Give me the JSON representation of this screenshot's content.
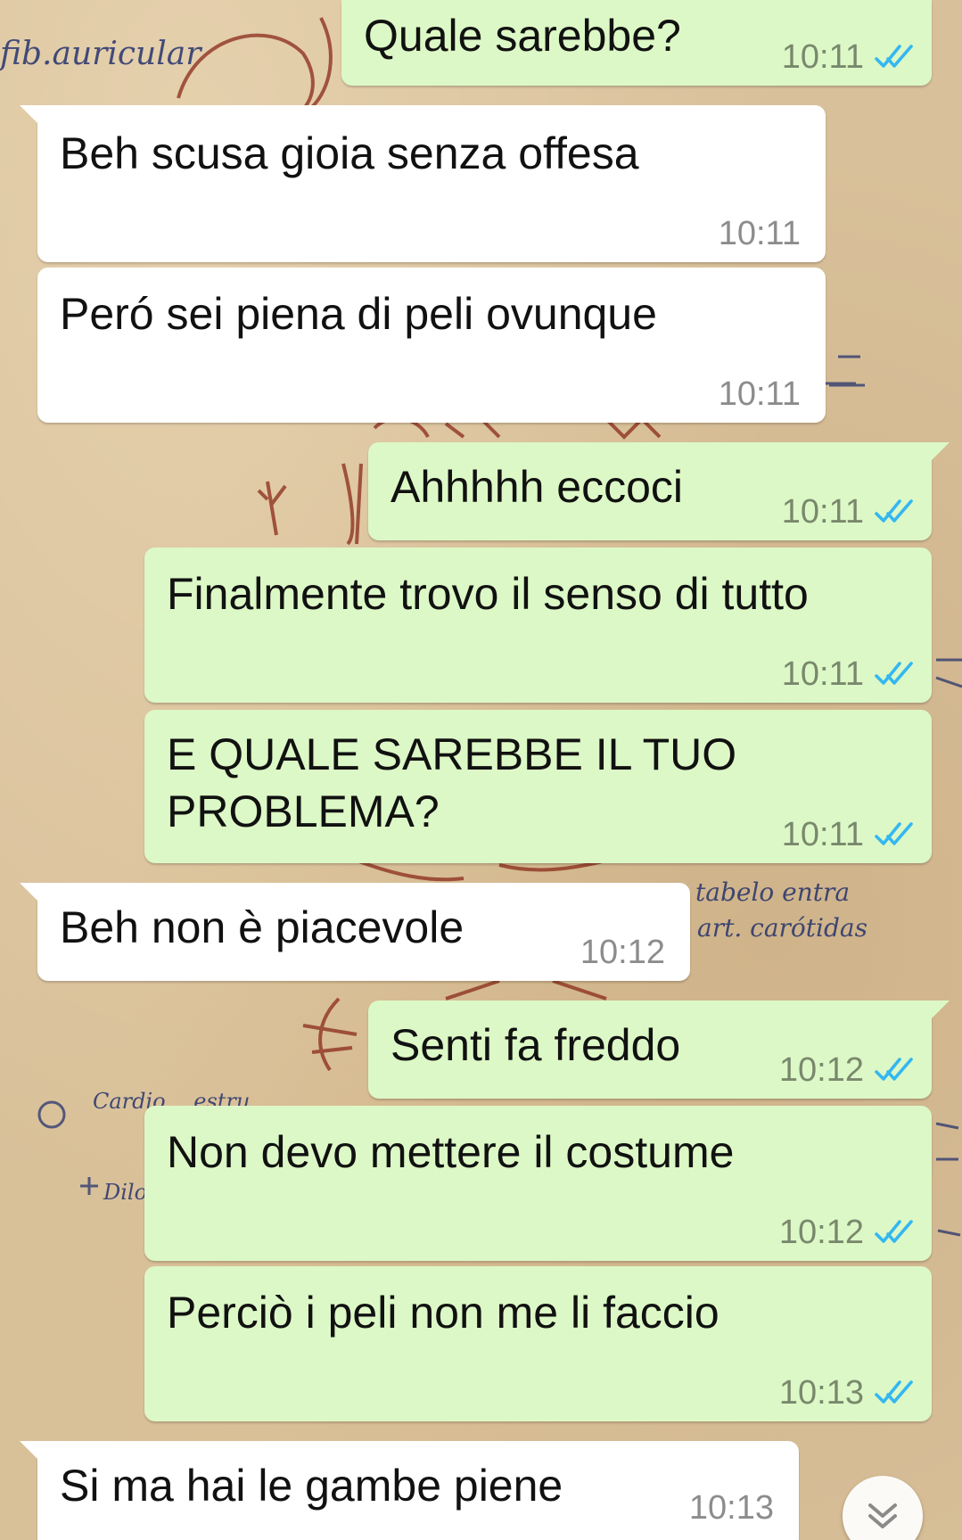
{
  "colors": {
    "incoming_bubble": "#ffffff",
    "outgoing_bubble": "#dcf8c6",
    "read_ticks": "#34b7f1",
    "timestamp": "#8a8a8a"
  },
  "wallpaper_annotations": {
    "fib_auricular": "fib.auricular",
    "tabelo_entra": "tabelo entra",
    "art_carotidas": "art. carótidas",
    "cardio_estru": "Cardio… estru",
    "dilo_auri": "Dilo auri"
  },
  "messages": [
    {
      "direction": "out",
      "text": "Quale sarebbe?",
      "time": "10:11",
      "status_icon": "double-check-icon"
    },
    {
      "direction": "in",
      "text": "Beh scusa gioia senza offesa",
      "time": "10:11"
    },
    {
      "direction": "in",
      "text": "Peró sei piena di peli ovunque",
      "time": "10:11"
    },
    {
      "direction": "out",
      "text": "Ahhhhh eccoci",
      "time": "10:11",
      "status_icon": "double-check-icon"
    },
    {
      "direction": "out",
      "text": "Finalmente trovo il senso di tutto",
      "time": "10:11",
      "status_icon": "double-check-icon"
    },
    {
      "direction": "out",
      "text": "E QUALE SAREBBE IL TUO\nPROBLEMA?",
      "time": "10:11",
      "status_icon": "double-check-icon"
    },
    {
      "direction": "in",
      "text": "Beh non è piacevole",
      "time": "10:12"
    },
    {
      "direction": "out",
      "text": "Senti fa freddo",
      "time": "10:12",
      "status_icon": "double-check-icon"
    },
    {
      "direction": "out",
      "text": "Non devo mettere il costume",
      "time": "10:12",
      "status_icon": "double-check-icon"
    },
    {
      "direction": "out",
      "text": "Perciò i peli non me li faccio",
      "time": "10:13",
      "status_icon": "double-check-icon"
    },
    {
      "direction": "in",
      "text": "Si ma hai le gambe piene",
      "time": "10:13"
    }
  ],
  "scroll_button": {
    "icon": "double-chevron-down-icon"
  }
}
